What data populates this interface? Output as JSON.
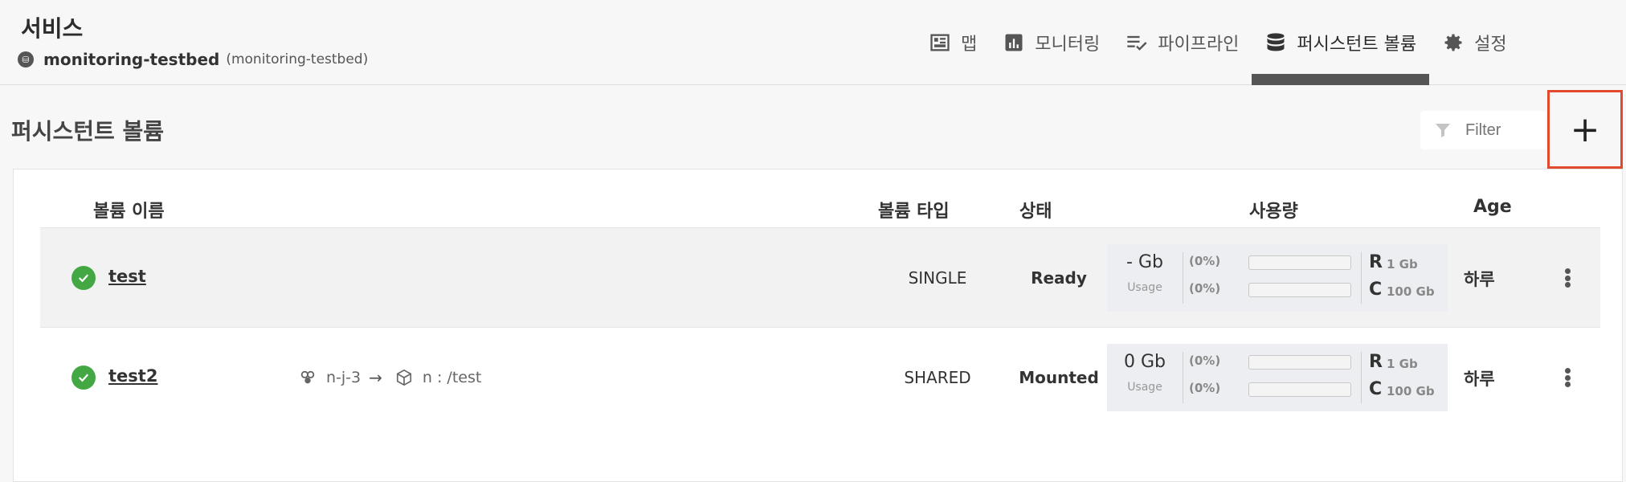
{
  "header": {
    "title": "서비스",
    "service_name": "monitoring-testbed",
    "service_sub": "(monitoring-testbed)"
  },
  "nav": {
    "items": [
      {
        "label": "맵",
        "icon": "map-icon"
      },
      {
        "label": "모니터링",
        "icon": "bar-chart-icon"
      },
      {
        "label": "파이프라인",
        "icon": "checklist-icon"
      },
      {
        "label": "퍼시스턴트 볼륨",
        "icon": "database-icon",
        "active": true
      },
      {
        "label": "설정",
        "icon": "gear-icon"
      }
    ]
  },
  "page": {
    "title": "퍼시스턴트 볼륨",
    "filter_placeholder": "Filter",
    "add_label": "+"
  },
  "table": {
    "headers": {
      "name": "볼륨 이름",
      "type": "볼륨 타입",
      "state": "상태",
      "usage": "사용량",
      "age": "Age"
    },
    "rows": [
      {
        "name": "test",
        "connection": null,
        "type": "SINGLE",
        "state": "Ready",
        "usage_value": "- Gb",
        "usage_label": "Usage",
        "r_pct": "(0%)",
        "c_pct": "(0%)",
        "r_label": "R",
        "r_value": "1 Gb",
        "c_label": "C",
        "c_value": "100 Gb",
        "r_fill": 0,
        "c_fill": 0,
        "age": "하루"
      },
      {
        "name": "test2",
        "connection": {
          "node": "n-j-3",
          "arrow": "→",
          "path": "n : /test"
        },
        "type": "SHARED",
        "state": "Mounted",
        "usage_value": "0 Gb",
        "usage_label": "Usage",
        "r_pct": "(0%)",
        "c_pct": "(0%)",
        "r_label": "R",
        "r_value": "1 Gb",
        "c_label": "C",
        "c_value": "100 Gb",
        "r_fill": 0,
        "c_fill": 0,
        "age": "하루"
      }
    ]
  },
  "colors": {
    "accent_red": "#e04a2e",
    "ok_green": "#43a843",
    "active_tab_bar": "#555555"
  }
}
